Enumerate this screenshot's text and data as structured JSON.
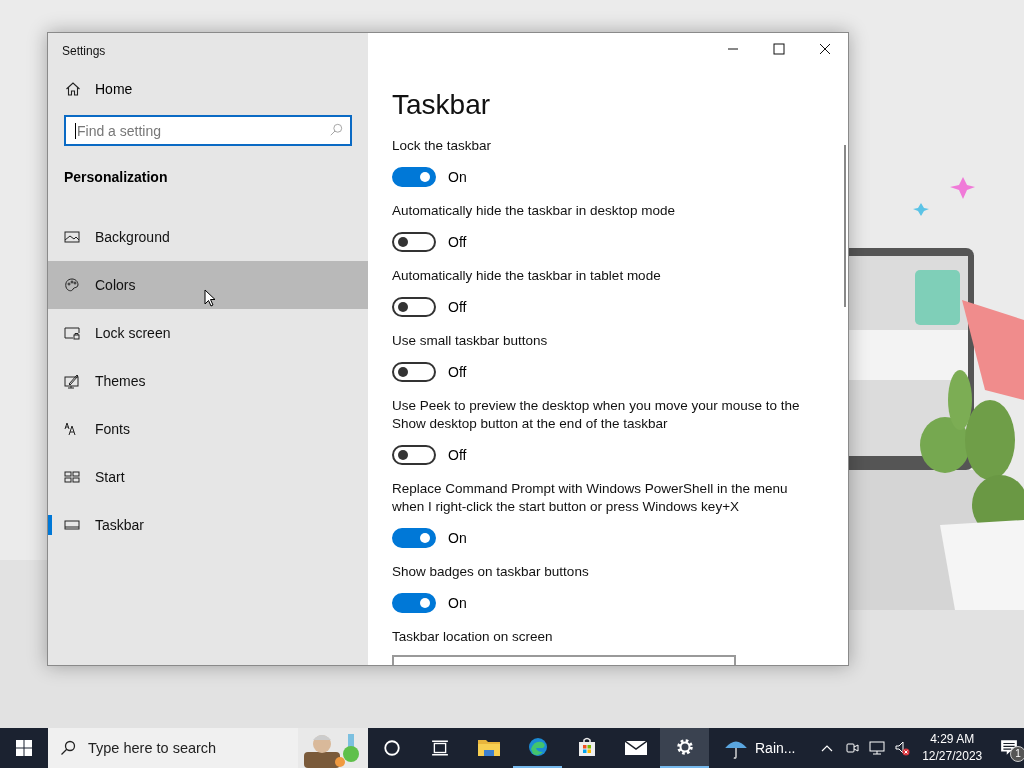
{
  "window": {
    "title": "Settings"
  },
  "sidebar": {
    "home": "Home",
    "search": {
      "placeholder": "Find a setting"
    },
    "section": "Personalization",
    "items": [
      {
        "label": "Background",
        "selected": false,
        "hovered": false
      },
      {
        "label": "Colors",
        "selected": false,
        "hovered": true
      },
      {
        "label": "Lock screen",
        "selected": false,
        "hovered": false
      },
      {
        "label": "Themes",
        "selected": false,
        "hovered": false
      },
      {
        "label": "Fonts",
        "selected": false,
        "hovered": false
      },
      {
        "label": "Start",
        "selected": false,
        "hovered": false
      },
      {
        "label": "Taskbar",
        "selected": true,
        "hovered": false
      }
    ]
  },
  "content": {
    "title": "Taskbar",
    "settings": [
      {
        "kind": "toggle",
        "label": "Lock the taskbar",
        "on": true,
        "state": "On"
      },
      {
        "kind": "toggle",
        "label": "Automatically hide the taskbar in desktop mode",
        "on": false,
        "state": "Off"
      },
      {
        "kind": "toggle",
        "label": "Automatically hide the taskbar in tablet mode",
        "on": false,
        "state": "Off"
      },
      {
        "kind": "toggle",
        "label": "Use small taskbar buttons",
        "on": false,
        "state": "Off"
      },
      {
        "kind": "toggle",
        "label": "Use Peek to preview the desktop when you move your mouse to the Show desktop button at the end of the taskbar",
        "on": false,
        "state": "Off"
      },
      {
        "kind": "toggle",
        "label": "Replace Command Prompt with Windows PowerShell in the menu when I right-click the start button or press Windows key+X",
        "on": true,
        "state": "On"
      },
      {
        "kind": "toggle",
        "label": "Show badges on taskbar buttons",
        "on": true,
        "state": "On"
      },
      {
        "kind": "dropdown",
        "label": "Taskbar location on screen"
      }
    ]
  },
  "taskbar": {
    "search": {
      "placeholder": "Type here to search"
    },
    "apps": [
      {
        "running": false,
        "selected": false
      },
      {
        "running": true,
        "selected": false
      },
      {
        "running": false,
        "selected": false
      },
      {
        "running": false,
        "selected": false
      },
      {
        "running": true,
        "selected": true
      }
    ],
    "weather": "Rain...",
    "time": "4:29 AM",
    "date": "12/27/2023",
    "notifications": "1"
  }
}
